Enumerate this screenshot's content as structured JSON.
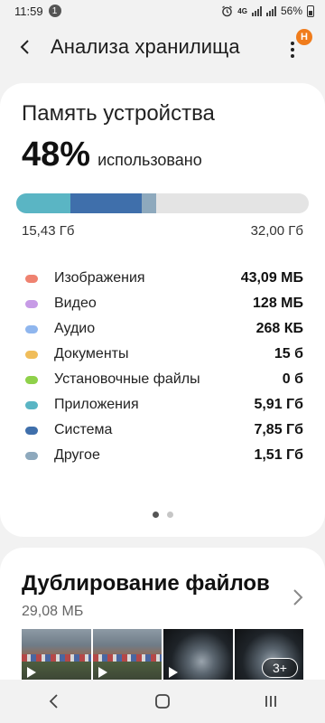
{
  "status_bar": {
    "time": "11:59",
    "notification_count": "1",
    "network_type": "4G",
    "battery_percent": "56%"
  },
  "header": {
    "title": "Анализа хранилища",
    "badge": "Н"
  },
  "device_storage": {
    "title": "Память устройства",
    "percent_used": "48%",
    "used_label": "использовано",
    "used_amount": "15,43 Гб",
    "total_amount": "32,00 Гб",
    "categories": [
      {
        "name": "Изображения",
        "value": "43,09 МБ",
        "color": "#ef8270"
      },
      {
        "name": "Видео",
        "value": "128 МБ",
        "color": "#c79be6"
      },
      {
        "name": "Аудио",
        "value": "268 КБ",
        "color": "#8fb6ee"
      },
      {
        "name": "Документы",
        "value": "15 б",
        "color": "#f0bd5a"
      },
      {
        "name": "Установочные файлы",
        "value": "0 б",
        "color": "#8fd14a"
      },
      {
        "name": "Приложения",
        "value": "5,91 Гб",
        "color": "#5ab5c4"
      },
      {
        "name": "Система",
        "value": "7,85 Гб",
        "color": "#3f6fab"
      },
      {
        "name": "Другое",
        "value": "1,51 Гб",
        "color": "#8ea9bd"
      }
    ],
    "bar_segments": [
      {
        "name": "Приложения",
        "fraction": 0.185,
        "color": "#5ab5c4"
      },
      {
        "name": "Система",
        "fraction": 0.245,
        "color": "#3f6fab"
      },
      {
        "name": "Другое",
        "fraction": 0.047,
        "color": "#8ea9bd"
      }
    ],
    "pager": {
      "pages": 2,
      "active": 0
    }
  },
  "duplicates": {
    "title": "Дублирование файлов",
    "size": "29,08 МБ",
    "more_count": "3+"
  },
  "colors": {
    "background": "#f2f2f2",
    "card": "#ffffff",
    "badge": "#f07c1c",
    "bar_track": "#e4e4e4"
  }
}
